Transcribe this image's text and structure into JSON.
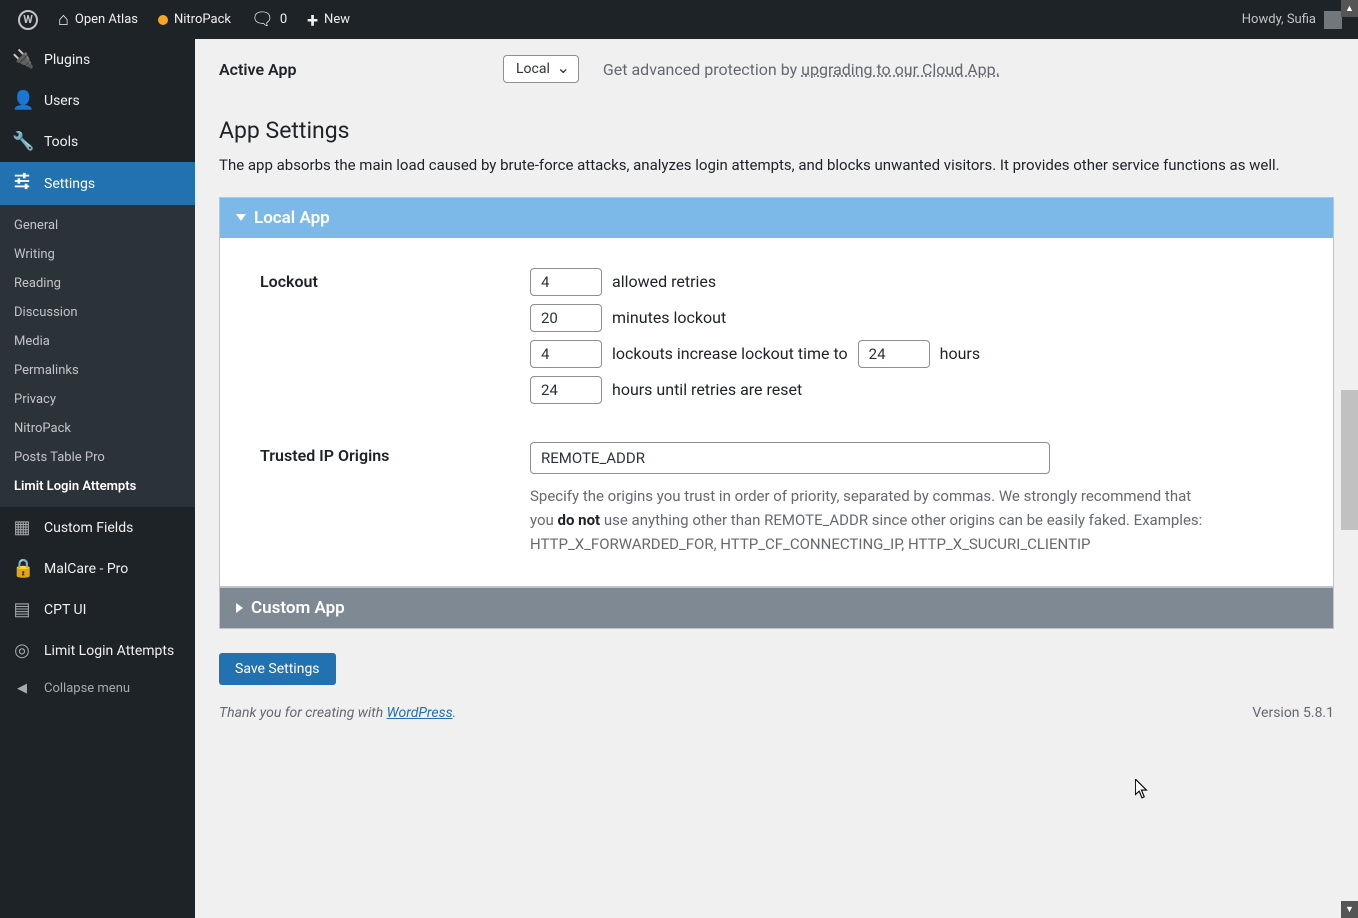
{
  "adminBar": {
    "siteName": "Open Atlas",
    "nitropack": "NitroPack",
    "commentsCount": "0",
    "newLabel": "New",
    "howdy": "Howdy, Sufia"
  },
  "sidebar": {
    "items": [
      {
        "label": "Plugins",
        "icon": "🔌"
      },
      {
        "label": "Users",
        "icon": "👤"
      },
      {
        "label": "Tools",
        "icon": "🔧"
      },
      {
        "label": "Settings",
        "icon": "⚙"
      }
    ],
    "settingsSub": [
      "General",
      "Writing",
      "Reading",
      "Discussion",
      "Media",
      "Permalinks",
      "Privacy",
      "NitroPack",
      "Posts Table Pro",
      "Limit Login Attempts"
    ],
    "after": [
      {
        "label": "Custom Fields",
        "icon": "▦"
      },
      {
        "label": "MalCare - Pro",
        "icon": "🔒"
      },
      {
        "label": "CPT UI",
        "icon": "▤"
      },
      {
        "label": "Limit Login Attempts",
        "icon": "◎"
      }
    ],
    "collapse": "Collapse menu"
  },
  "activeApp": {
    "label": "Active App",
    "selected": "Local",
    "protectionPrefix": "Get advanced protection by ",
    "protectionLink": "upgrading to our Cloud App."
  },
  "page": {
    "heading": "App Settings",
    "desc": "The app absorbs the main load caused by brute-force attacks, analyzes login attempts, and blocks unwanted visitors. It provides other service functions as well."
  },
  "panels": {
    "localTitle": "Local App",
    "customTitle": "Custom App"
  },
  "lockout": {
    "label": "Lockout",
    "retries": "4",
    "retriesText": "allowed retries",
    "minutes": "20",
    "minutesText": "minutes lockout",
    "lockouts": "4",
    "increaseText1": "lockouts increase lockout time to",
    "hours": "24",
    "increaseText2": "hours",
    "resetHours": "24",
    "resetText": "hours until retries are reset"
  },
  "trusted": {
    "label": "Trusted IP Origins",
    "value": "REMOTE_ADDR",
    "help1": "Specify the origins you trust in order of priority, separated by commas. We strongly recommend that you ",
    "helpBold": "do not",
    "help2": " use anything other than REMOTE_ADDR since other origins can be easily faked. Examples: HTTP_X_FORWARDED_FOR, HTTP_CF_CONNECTING_IP, HTTP_X_SUCURI_CLIENTIP"
  },
  "saveButton": "Save Settings",
  "footer": {
    "thanks": "Thank you for creating with ",
    "link": "WordPress",
    "period": ".",
    "version": "Version 5.8.1"
  }
}
